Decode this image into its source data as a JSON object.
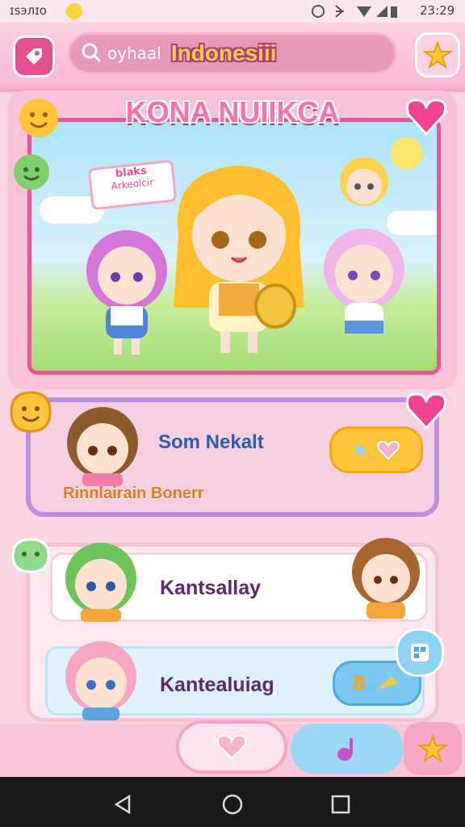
{
  "status_bar": {
    "carrier": "ɪsэлɪo",
    "time": "23:29"
  },
  "header": {
    "search_hint": "oyhaal",
    "search_value": "Indonesiii"
  },
  "banner": {
    "title": "KONA NUIIKCA",
    "sign_line1": "blaks",
    "sign_line2": "Arkeolcir"
  },
  "cards": [
    {
      "name": "Som Nekalt",
      "subtitle": "Rinnlairain Bonerr"
    },
    {
      "name": "Kantsallay"
    },
    {
      "name": "Kantealuiag",
      "badge": "8"
    }
  ],
  "colors": {
    "accent_pink": "#e45797",
    "gold": "#ffc53a",
    "lilac": "#b990e1",
    "sky": "#8fd3f4"
  },
  "icons": [
    "search-icon",
    "star-icon",
    "heart-icon",
    "smiley-icon",
    "menu-icon",
    "back-icon",
    "home-icon",
    "recents-icon"
  ]
}
